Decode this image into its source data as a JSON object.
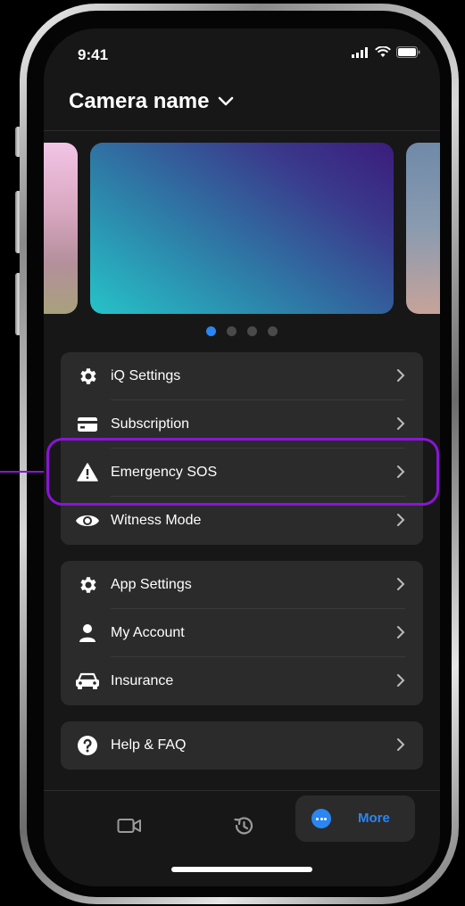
{
  "status_bar": {
    "time": "9:41"
  },
  "header": {
    "title": "Camera name"
  },
  "carousel": {
    "page_count": 4,
    "active_index": 0
  },
  "menu_groups": [
    {
      "items": [
        {
          "label": "iQ Settings",
          "icon": "gear-icon"
        },
        {
          "label": "Subscription",
          "icon": "credit-card-icon"
        },
        {
          "label": "Emergency SOS",
          "icon": "warning-icon",
          "highlighted": true
        },
        {
          "label": "Witness Mode",
          "icon": "eye-icon"
        }
      ]
    },
    {
      "items": [
        {
          "label": "App Settings",
          "icon": "gear-icon"
        },
        {
          "label": "My Account",
          "icon": "person-icon"
        },
        {
          "label": "Insurance",
          "icon": "car-icon"
        }
      ]
    },
    {
      "items": [
        {
          "label": "Help & FAQ",
          "icon": "help-circle-icon"
        }
      ]
    }
  ],
  "tabbar": {
    "tabs": [
      {
        "icon": "video-camera-icon"
      },
      {
        "icon": "history-icon"
      },
      {
        "icon": "more-icon",
        "label": "More",
        "active": true
      }
    ]
  },
  "colors": {
    "accent": "#2a86f2",
    "highlight": "#8a14d6",
    "background": "#171717",
    "surface": "#2b2b2c"
  }
}
